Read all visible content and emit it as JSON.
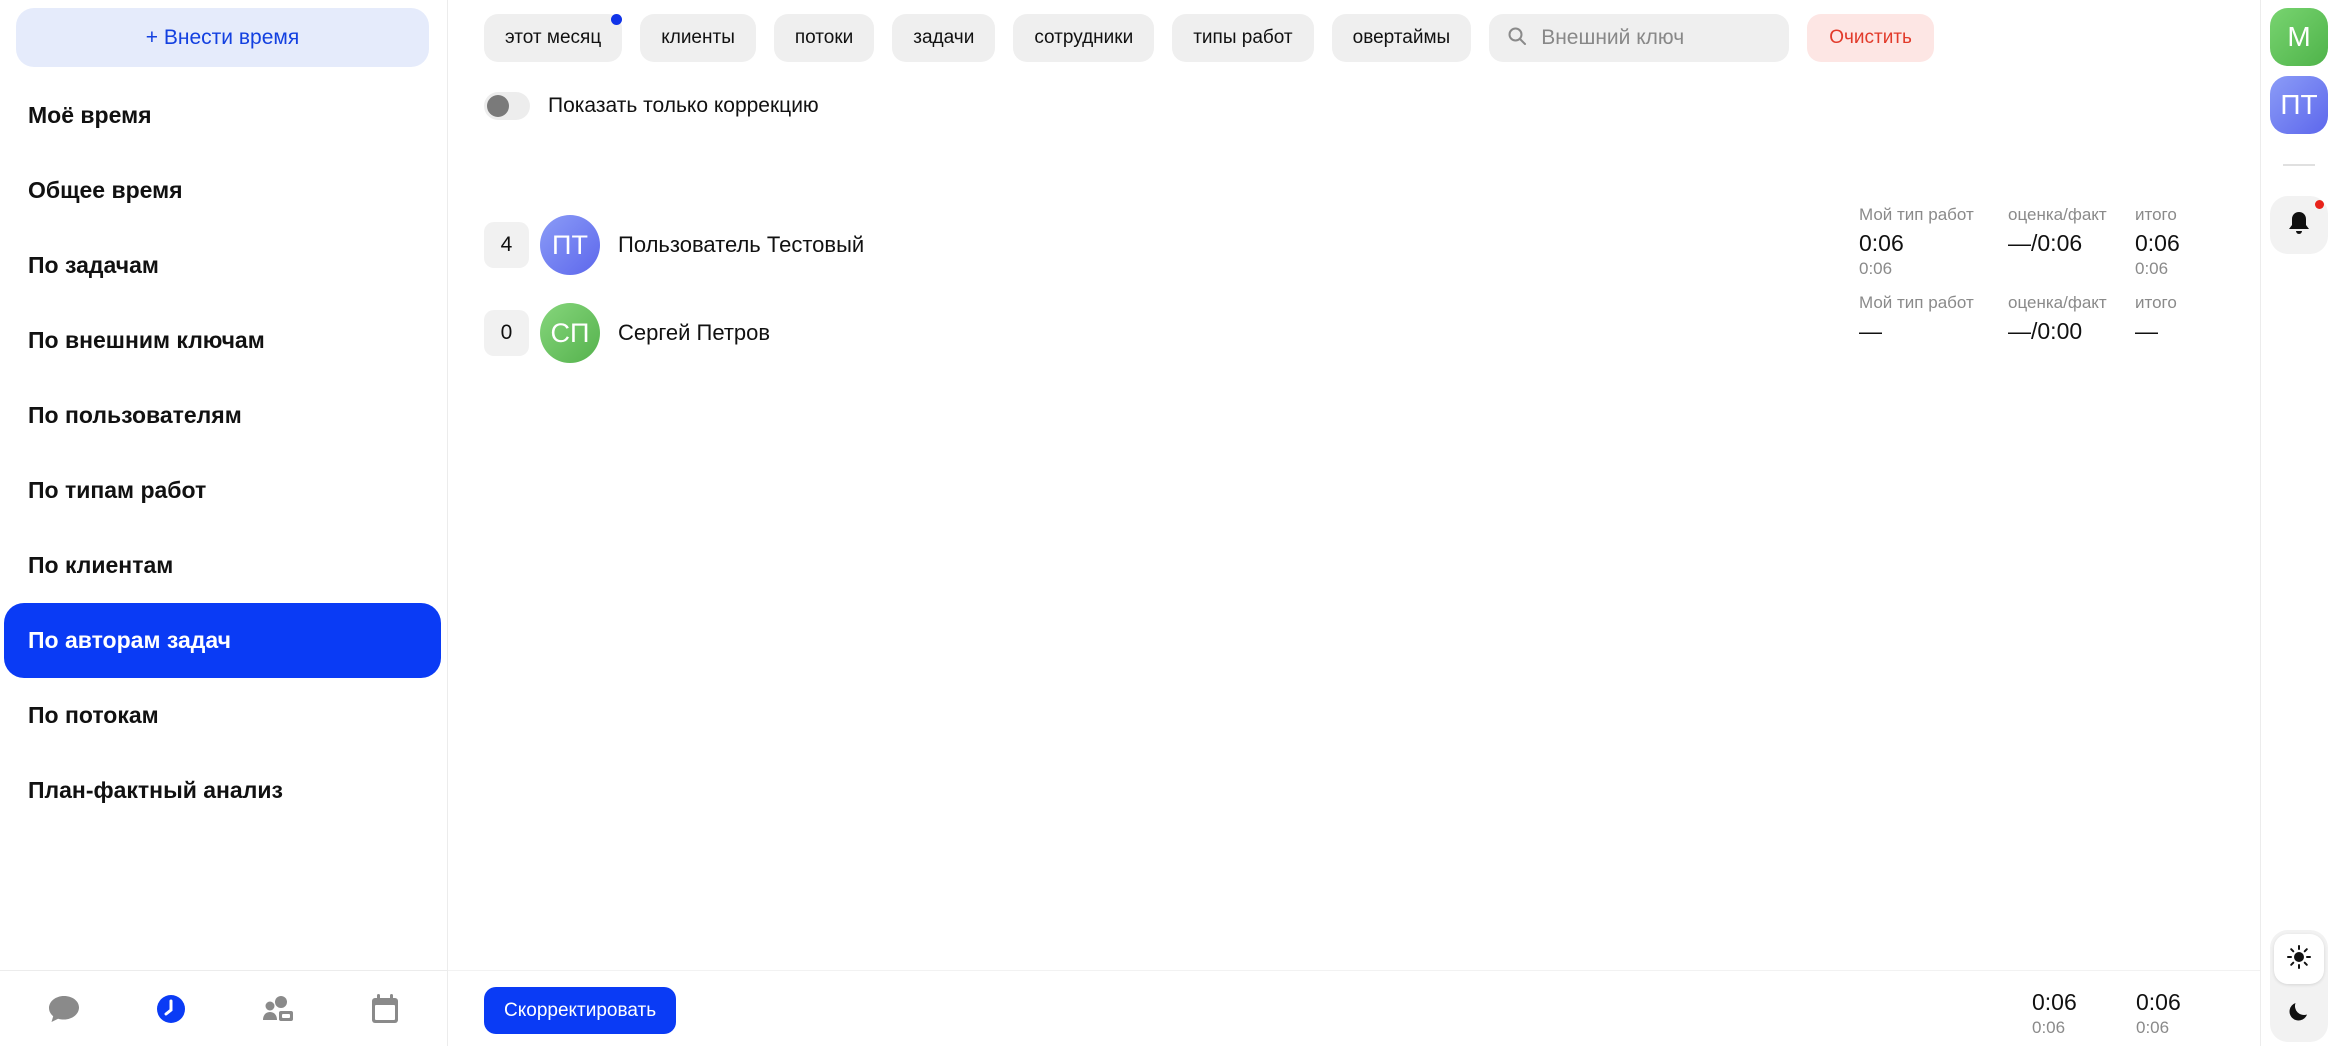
{
  "sidebar": {
    "add_time_label": "+ Внести время",
    "items": [
      {
        "label": "Моё время",
        "active": false
      },
      {
        "label": "Общее время",
        "active": false
      },
      {
        "label": "По задачам",
        "active": false
      },
      {
        "label": "По внешним ключам",
        "active": false
      },
      {
        "label": "По пользователям",
        "active": false
      },
      {
        "label": "По типам работ",
        "active": false
      },
      {
        "label": "По клиентам",
        "active": false
      },
      {
        "label": "По авторам задач",
        "active": true
      },
      {
        "label": "По потокам",
        "active": false
      },
      {
        "label": "План-фактный анализ",
        "active": false
      }
    ],
    "bottom_icons": [
      "chat-icon",
      "clock-icon",
      "people-icon",
      "calendar-icon"
    ]
  },
  "filters": {
    "chips": [
      "этот месяц",
      "клиенты",
      "потоки",
      "задачи",
      "сотрудники",
      "типы работ",
      "овертаймы"
    ],
    "search_placeholder": "Внешний ключ",
    "clear_label": "Очистить"
  },
  "toggle": {
    "label": "Показать только коррекцию",
    "on": false
  },
  "rows": [
    {
      "count": "4",
      "initials": "ПТ",
      "name": "Пользователь Тестовый",
      "color": "#6e7ef2",
      "stats": {
        "my_type_label": "Мой тип работ",
        "my_type_value": "0:06",
        "my_type_sub": "0:06",
        "estimate_label": "оценка/факт",
        "estimate_value": "—/0:06",
        "total_label": "итого",
        "total_value": "0:06",
        "total_sub": "0:06"
      }
    },
    {
      "count": "0",
      "initials": "СП",
      "name": "Сергей Петров",
      "color": "#6cc464",
      "stats": {
        "my_type_label": "Мой тип работ",
        "my_type_value": "—",
        "my_type_sub": "",
        "estimate_label": "оценка/факт",
        "estimate_value": "—/0:00",
        "total_label": "итого",
        "total_value": "—",
        "total_sub": ""
      }
    }
  ],
  "footer": {
    "correct_label": "Скорректировать",
    "totals": [
      {
        "value": "0:06",
        "sub": "0:06"
      },
      {
        "value": "0:06",
        "sub": "0:06"
      }
    ]
  },
  "rail": {
    "avatars": [
      {
        "initials": "М",
        "color": "#5cc05a"
      },
      {
        "initials": "ПТ",
        "color": "#6e7ef2"
      }
    ]
  },
  "colors": {
    "accent": "#0a3bf5",
    "danger": "#e23a2a",
    "notification_dot": "#e8231b"
  }
}
